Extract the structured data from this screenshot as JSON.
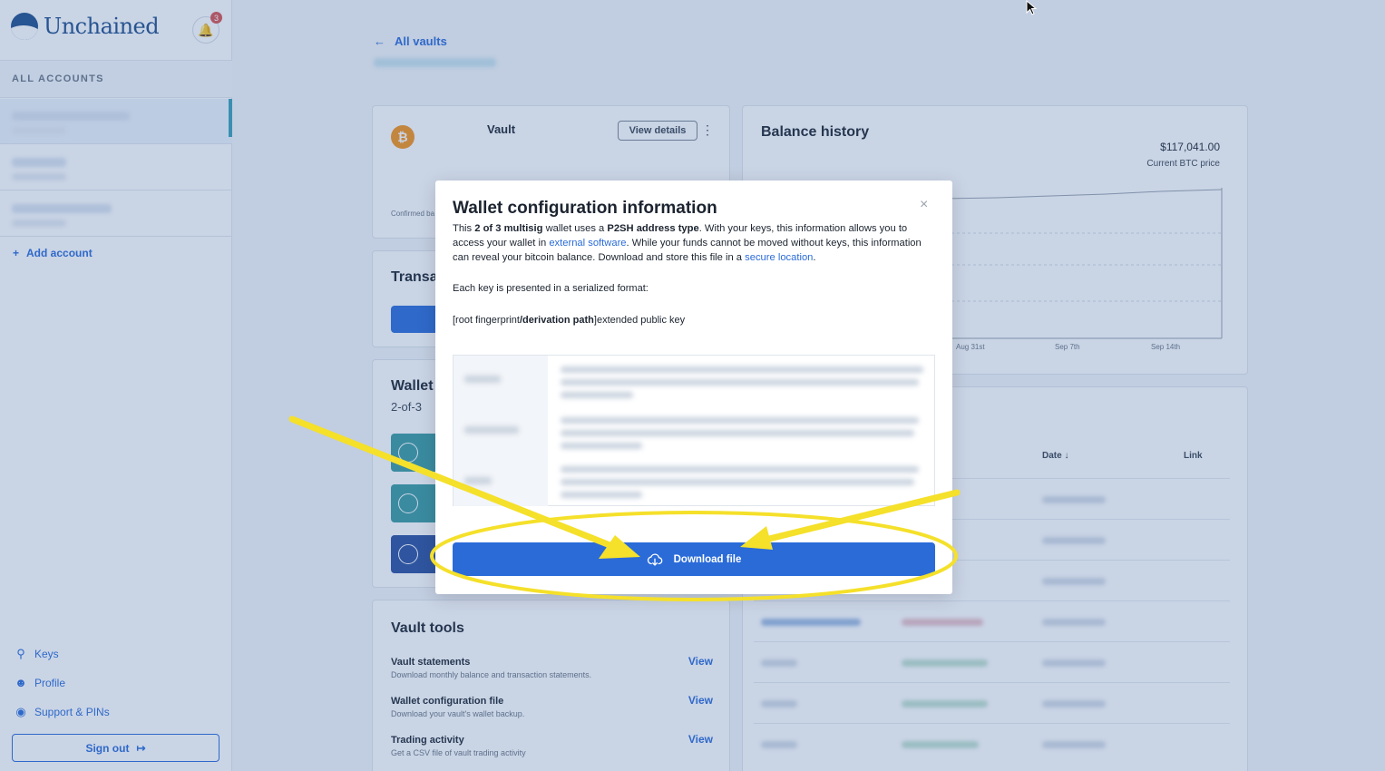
{
  "sidebar": {
    "brand": "Unchained",
    "notifications_count": "3",
    "accounts_heading": "ALL ACCOUNTS",
    "add_account": "Add account",
    "links": [
      "Keys",
      "Profile",
      "Support & PINs"
    ],
    "sign_out": "Sign out"
  },
  "main": {
    "back_link": "All vaults",
    "vault_card": {
      "name": "Vault",
      "view_details": "View details",
      "confirmed_label": "Confirmed ba"
    },
    "transactions_title": "Transa",
    "wallet_title": "Wallet",
    "wallet_subtitle": "2-of-3",
    "vault_tools": {
      "title": "Vault tools",
      "items": [
        {
          "title": "Vault statements",
          "desc": "Download monthly balance and transaction statements.",
          "action": "View"
        },
        {
          "title": "Wallet configuration file",
          "desc": "Download your vault's wallet backup.",
          "action": "View"
        },
        {
          "title": "Trading activity",
          "desc": "Get a CSV file of vault trading activity",
          "action": "View"
        }
      ]
    },
    "balance_history": {
      "title": "Balance history",
      "price": "$117,041.00",
      "price_label": "Current BTC price",
      "x_ticks": [
        "Aug 31st",
        "Sep 7th",
        "Sep 14th"
      ]
    },
    "tx_table": {
      "col_date": "Date",
      "col_link": "Link"
    }
  },
  "modal": {
    "title": "Wallet configuration information",
    "body_1": "This ",
    "body_bold_1": "2 of 3 multisig",
    "body_2": " wallet uses a ",
    "body_bold_2": "P2SH address type",
    "body_3": ". With your keys, this information allows you to access your wallet in ",
    "link_1": "external software",
    "body_4": ". While your funds cannot be moved without keys, this information can reveal your bitcoin balance. Download and store this file in a ",
    "link_2": "secure location",
    "body_5": ".",
    "format_intro": "Each key is presented in a serialized format:",
    "format_pre": "[root fingerprint",
    "format_bold": "/derivation path",
    "format_post": "]extended public key",
    "download_button": "Download file",
    "close": "×"
  },
  "colors": {
    "accent": "#2a6bd8",
    "annotation": "#f5e02a",
    "overlay": "#3c64a0"
  }
}
